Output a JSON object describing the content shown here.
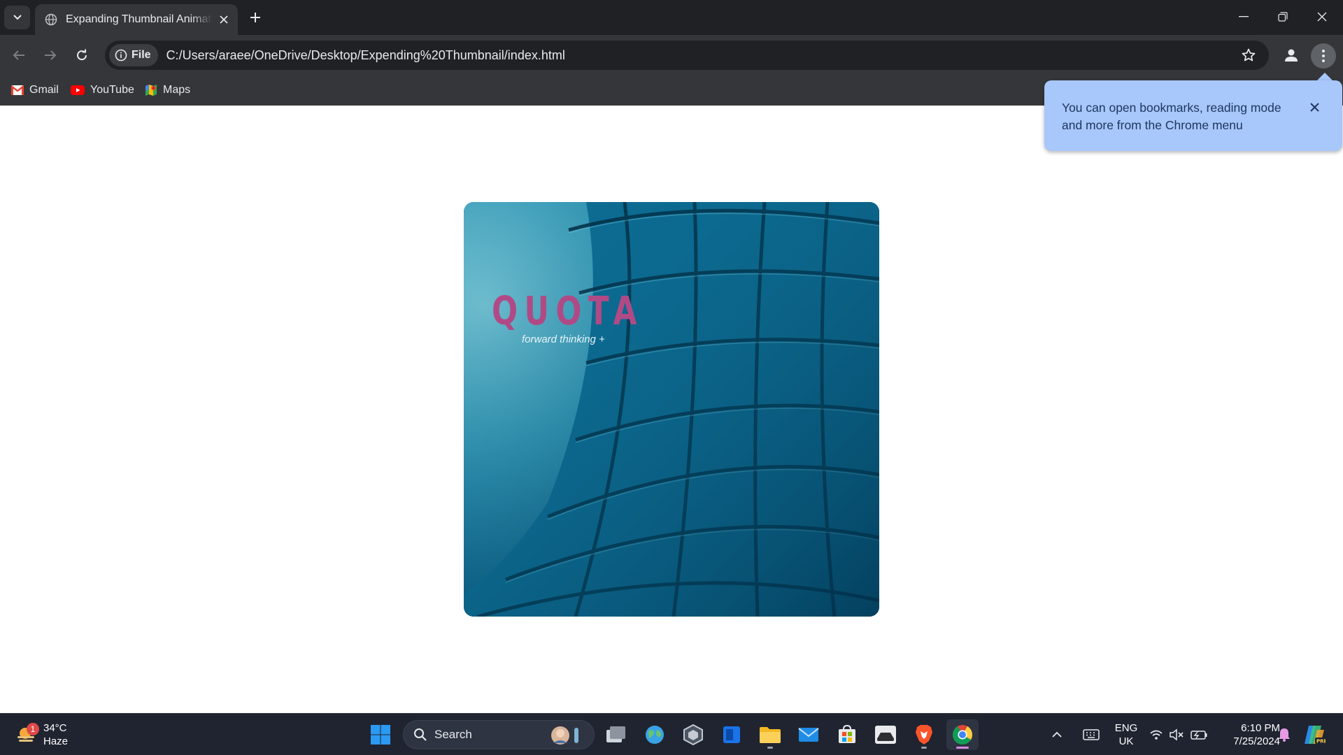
{
  "browser": {
    "tab": {
      "title": "Expanding Thumbnail Animation"
    },
    "address": {
      "chip_label": "File",
      "url": "C:/Users/araee/OneDrive/Desktop/Expending%20Thumbnail/index.html"
    },
    "bookmarks": [
      {
        "label": "Gmail",
        "icon": "gmail-icon"
      },
      {
        "label": "YouTube",
        "icon": "youtube-icon"
      },
      {
        "label": "Maps",
        "icon": "maps-icon"
      }
    ],
    "popup": {
      "text": "You can open bookmarks, reading mode and more from the Chrome menu"
    }
  },
  "page": {
    "thumbnail": {
      "brand": "QUOTA",
      "tagline": "forward thinking +",
      "brand_color": "#b04a86"
    }
  },
  "taskbar": {
    "weather": {
      "temp": "34°C",
      "condition": "Haze",
      "badge": "1"
    },
    "search_label": "Search",
    "language": {
      "line1": "ENG",
      "line2": "UK"
    },
    "clock": {
      "time": "6:10 PM",
      "date": "7/25/2024"
    }
  },
  "colors": {
    "tabstrip": "#202124",
    "toolbar": "#35363a",
    "popup": "#a8c7fa",
    "taskbar": "#1f2430"
  }
}
